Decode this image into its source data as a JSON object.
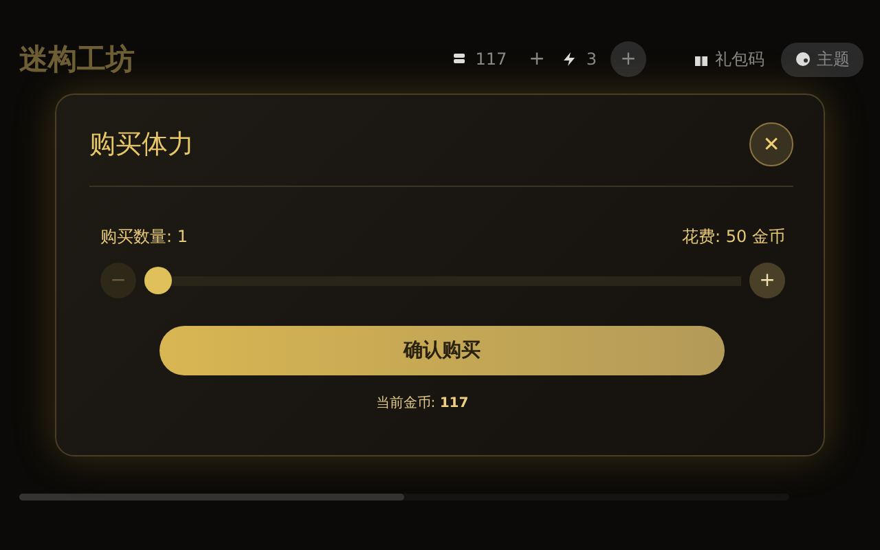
{
  "header": {
    "title": "迷构工坊",
    "coins": "117",
    "coins_add": "+",
    "energy": "3",
    "energy_add": "+",
    "gift_code": "礼包码",
    "theme": "主题"
  },
  "dialog": {
    "title": "购买体力",
    "close": "✕",
    "quantity_label": "购买数量: 1",
    "cost_label": "花费: 50 金币",
    "slider": {
      "minus": "−",
      "plus": "+",
      "level": 0
    },
    "confirm": "确认购买",
    "balance_label": "当前金币: ",
    "balance_value": "117"
  },
  "background_progress": {
    "level": 0.5
  }
}
